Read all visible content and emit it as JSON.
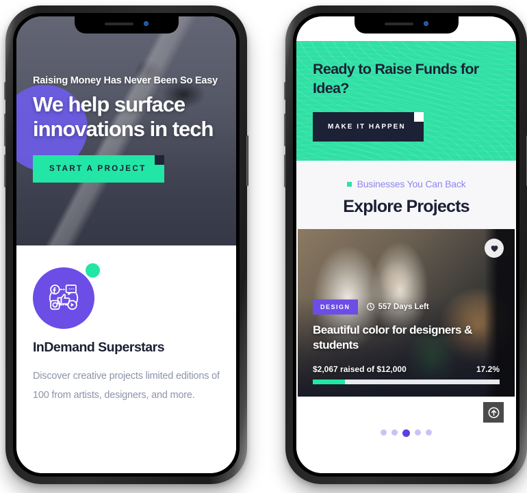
{
  "left_phone": {
    "hero": {
      "eyebrow": "Raising Money Has Never Been So Easy",
      "title": "We help surface innovations in tech",
      "cta_label": "START A PROJECT",
      "cta_bg": "#22e6a5",
      "accent_square": "#20243a"
    },
    "feature": {
      "icon_name": "social-media-icon",
      "icon_bg": "#6c4de6",
      "dot_color": "#22e6a5",
      "title": "InDemand Superstars",
      "body": "Discover creative projects limited editions of 100 from artists, designers, and more."
    }
  },
  "right_phone": {
    "banner": {
      "title": "Ready to Raise Funds for Idea?",
      "cta_label": "MAKE IT HAPPEN",
      "bg": "#2fe0a4",
      "cta_bg": "#1d2135",
      "accent_square": "#ffffff"
    },
    "section": {
      "eyebrow": "Businesses You Can Back",
      "eyebrow_color": "#8e84ef",
      "bullet_color": "#2fe0a4",
      "title": "Explore Projects"
    },
    "project_card": {
      "category": "DESIGN",
      "category_bg": "#6c4de6",
      "days_left": "557 Days Left",
      "title": "Beautiful color for designers & students",
      "raised_text": "$2,067 raised of $12,000",
      "percent_text": "17.2%",
      "progress_percent": 17.2,
      "progress_color": "#22e6a5",
      "favorite_icon": "heart-icon"
    },
    "footer": {
      "scroll_top_icon": "arrow-up-circle-icon",
      "dots_total": 5,
      "dots_active_index": 2,
      "dot_color": "#c9c3f5",
      "dot_active_color": "#5b3fe0"
    }
  }
}
